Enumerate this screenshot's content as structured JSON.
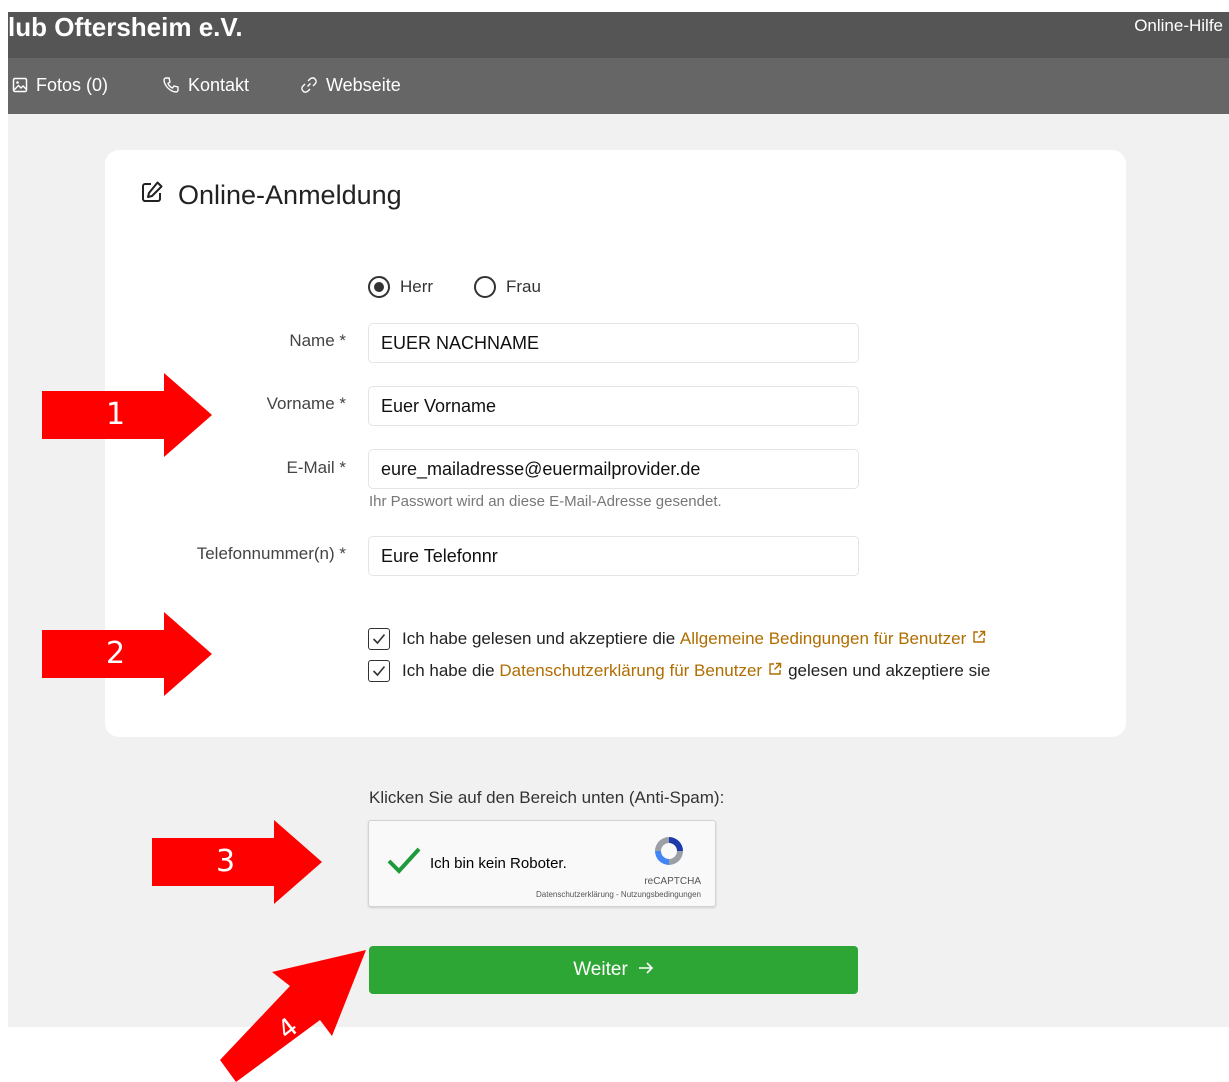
{
  "header": {
    "club_name": "lub Oftersheim e.V.",
    "help_link": "Online-Hilfe",
    "nav": [
      {
        "label": "Fotos (0)",
        "icon": "image-icon"
      },
      {
        "label": "Kontakt",
        "icon": "phone-icon"
      },
      {
        "label": "Webseite",
        "icon": "link-icon"
      }
    ]
  },
  "form": {
    "title": "Online-Anmeldung",
    "salutation": {
      "options": [
        "Herr",
        "Frau"
      ],
      "selected": "Herr"
    },
    "fields": {
      "name": {
        "label": "Name *",
        "value": "EUER NACHNAME"
      },
      "vorname": {
        "label": "Vorname *",
        "value": "Euer Vorname"
      },
      "email": {
        "label": "E-Mail *",
        "value": "eure_mailadresse@euermailprovider.de",
        "hint": "Ihr Passwort wird an diese E-Mail-Adresse gesendet."
      },
      "phone": {
        "label": "Telefonnummer(n) *",
        "value": "Eure Telefonnr"
      }
    },
    "consent": {
      "terms_prefix": "Ich habe gelesen und akzeptiere die",
      "terms_link": "Allgemeine Bedingungen für Benutzer",
      "privacy_prefix": "Ich habe die",
      "privacy_link": "Datenschutzerklärung für Benutzer",
      "privacy_suffix": "gelesen und akzeptiere sie",
      "terms_checked": true,
      "privacy_checked": true
    }
  },
  "antispam": {
    "label": "Klicken Sie auf den Bereich unten (Anti-Spam):",
    "captcha_text": "Ich bin kein Roboter.",
    "brand": "reCAPTCHA",
    "links": "Datenschutzerklärung - Nutzungsbedingungen",
    "checked": true
  },
  "submit": {
    "label": "Weiter",
    "icon": "arrow-right-icon"
  },
  "annotations": {
    "arrow_labels": [
      "1",
      "2",
      "3",
      "4"
    ],
    "color": "#ff0000"
  },
  "colors": {
    "accent_green": "#2ea636",
    "link_gold": "#b06d00",
    "header_dark": "#555555"
  }
}
